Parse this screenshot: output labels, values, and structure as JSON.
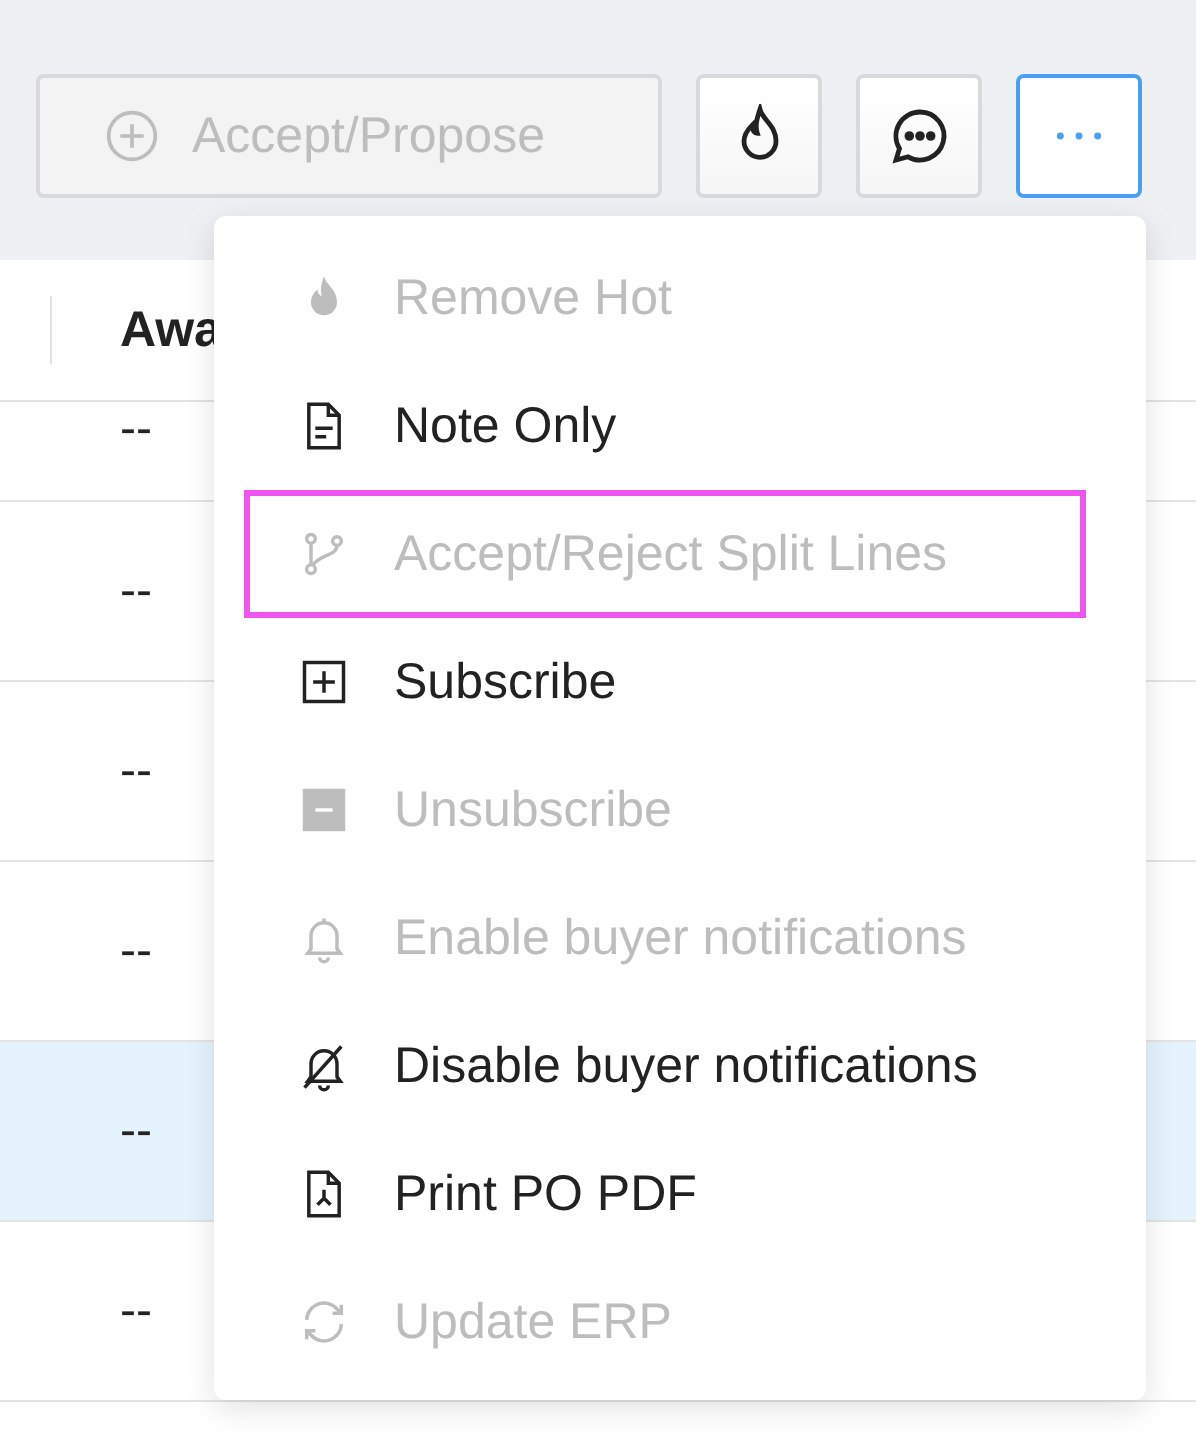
{
  "toolbar": {
    "buttons": [
      {
        "kind": "primary",
        "label": "Accept/Propose",
        "disabled": true,
        "active": false
      },
      {
        "kind": "hot",
        "disabled": false,
        "active": false
      },
      {
        "kind": "comment",
        "disabled": false,
        "active": false
      },
      {
        "kind": "more",
        "disabled": false,
        "active": true
      }
    ]
  },
  "table": {
    "columns": [
      "Awa"
    ],
    "rows": [
      {
        "cells": [
          "--"
        ],
        "selected": false
      },
      {
        "cells": [
          "--"
        ],
        "selected": false
      },
      {
        "cells": [
          "--"
        ],
        "selected": false
      },
      {
        "cells": [
          "--"
        ],
        "selected": false
      },
      {
        "cells": [
          "--"
        ],
        "selected": true
      },
      {
        "cells": [
          "--"
        ],
        "selected": false
      }
    ]
  },
  "menu": {
    "items": [
      {
        "kind": "flame",
        "label": "Remove Hot",
        "disabled": true,
        "highlighted": false
      },
      {
        "kind": "document",
        "label": "Note Only",
        "disabled": false,
        "highlighted": false
      },
      {
        "kind": "branch",
        "label": "Accept/Reject Split Lines",
        "disabled": true,
        "highlighted": true
      },
      {
        "kind": "plus-square",
        "label": "Subscribe",
        "disabled": false,
        "highlighted": false
      },
      {
        "kind": "minus-square",
        "label": "Unsubscribe",
        "disabled": true,
        "highlighted": false
      },
      {
        "kind": "bell",
        "label": "Enable buyer notifications",
        "disabled": true,
        "highlighted": false
      },
      {
        "kind": "bell-off",
        "label": "Disable buyer notifications",
        "disabled": false,
        "highlighted": false
      },
      {
        "kind": "pdf",
        "label": "Print PO PDF",
        "disabled": false,
        "highlighted": false
      },
      {
        "kind": "refresh",
        "label": "Update ERP",
        "disabled": true,
        "highlighted": false
      }
    ]
  }
}
